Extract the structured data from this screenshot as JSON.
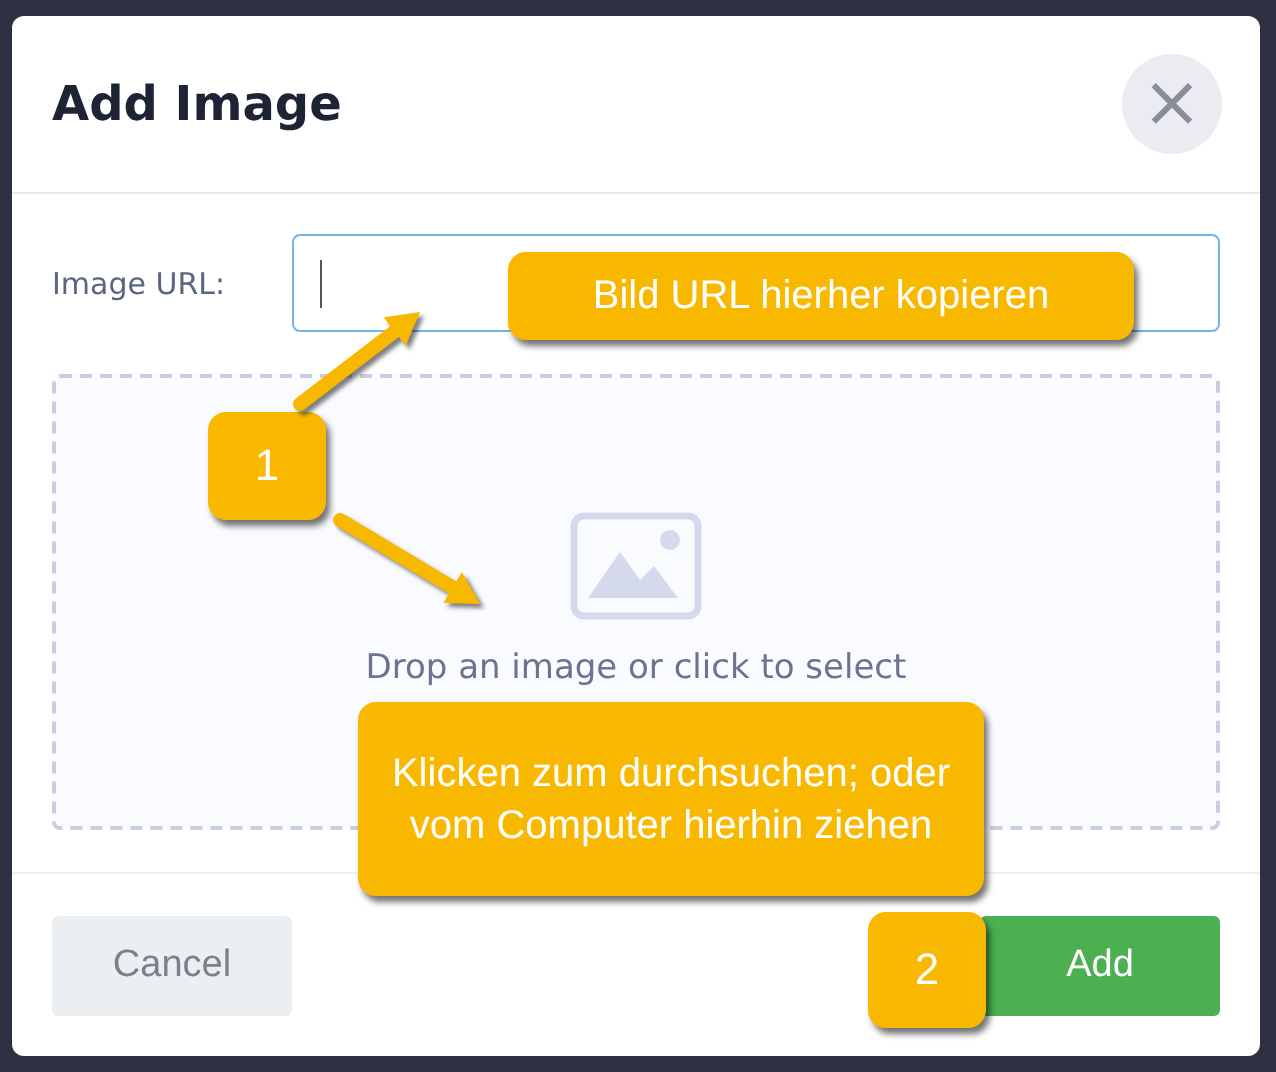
{
  "dialog": {
    "title": "Add Image",
    "close_button": "×",
    "url_field": {
      "label": "Image URL:",
      "focused": true
    },
    "dropzone": {
      "text": "Drop an image or click to select"
    },
    "buttons": [
      {
        "kind": "secondary",
        "label": "Cancel"
      },
      {
        "kind": "primary",
        "label": "Add"
      }
    ]
  },
  "annotations": [
    {
      "kind": "callout",
      "text": "Bild URL hierher kopieren"
    },
    {
      "kind": "number",
      "text": "1"
    },
    {
      "kind": "callout",
      "text": "Klicken zum durchsuchen; oder vom Computer hierhin ziehen"
    },
    {
      "kind": "number",
      "text": "2"
    }
  ]
}
